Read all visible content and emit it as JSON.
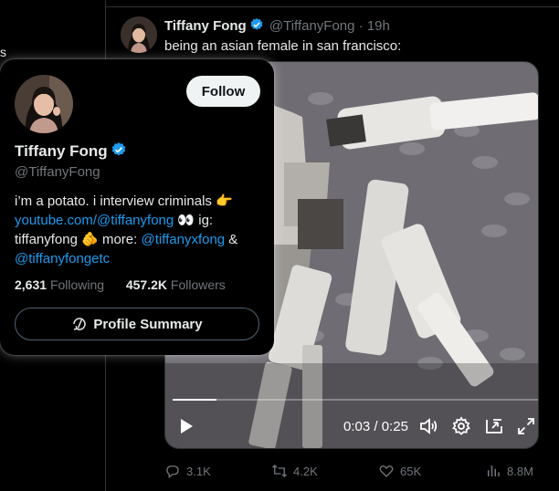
{
  "tweet": {
    "author_name": "Tiffany Fong",
    "handle": "@TiffanyFong",
    "separator": "·",
    "age": "19h",
    "text": "being an asian female in san francisco:"
  },
  "video": {
    "current_time": "0:03",
    "time_separator": "/",
    "duration": "0:25",
    "progress_fraction": 0.12
  },
  "actions": {
    "replies": "3.1K",
    "reposts": "4.2K",
    "likes": "65K",
    "views": "8.8M"
  },
  "hover_card": {
    "follow_label": "Follow",
    "name": "Tiffany Fong",
    "handle": "@TiffanyFong",
    "bio_part1": "i’m a potato. i interview criminals 👉",
    "bio_link1": "youtube.com/@tiffanyfong",
    "bio_part2": " 👀 ig: tiffanyfong 🫵 more: ",
    "bio_link2": "@tiffanyxfong",
    "bio_part3": " & ",
    "bio_link3": "@tiffanyfongetc",
    "following_count": "2,631",
    "following_label": "Following",
    "followers_count": "457.2K",
    "followers_label": "Followers",
    "summary_label": "Profile Summary"
  },
  "colors": {
    "accent": "#1d9bf0",
    "background": "#000000",
    "muted": "#71767b"
  },
  "icons": [
    "verified-badge-icon",
    "play-icon",
    "volume-icon",
    "settings-icon",
    "pip-icon",
    "fullscreen-icon",
    "reply-icon",
    "repost-icon",
    "like-icon",
    "views-icon",
    "profile-summary-icon"
  ]
}
